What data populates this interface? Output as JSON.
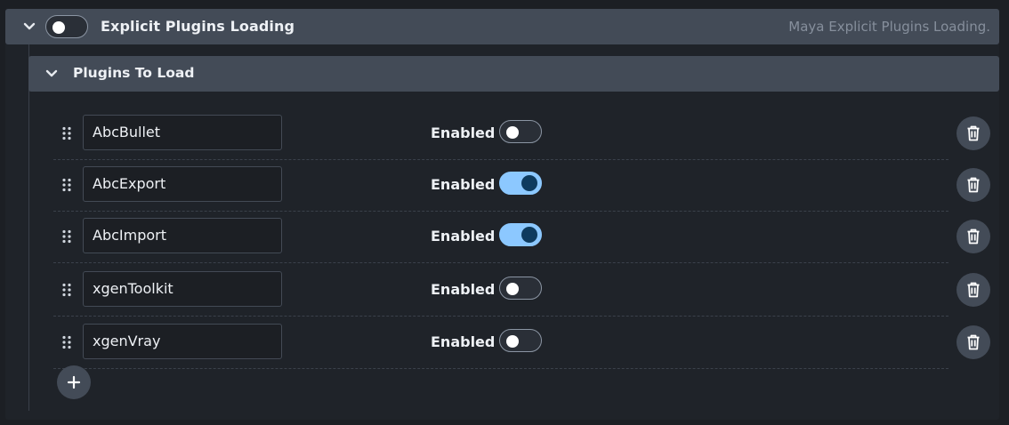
{
  "section": {
    "title": "Explicit Plugins Loading",
    "description": "Maya Explicit Plugins Loading.",
    "enabled": false,
    "expanded": true
  },
  "subsection": {
    "title": "Plugins To Load",
    "expanded": true
  },
  "plugins": [
    {
      "name": "AbcBullet",
      "enabled_label": "Enabled",
      "enabled": false
    },
    {
      "name": "AbcExport",
      "enabled_label": "Enabled",
      "enabled": true
    },
    {
      "name": "AbcImport",
      "enabled_label": "Enabled",
      "enabled": true
    },
    {
      "name": "xgenToolkit",
      "enabled_label": "Enabled",
      "enabled": false
    },
    {
      "name": "xgenVray",
      "enabled_label": "Enabled",
      "enabled": false
    }
  ],
  "icons": {
    "collapse": "chevron-down-icon",
    "drag": "drag-handle-icon",
    "delete": "trash-icon",
    "add": "plus-icon"
  },
  "colors": {
    "header_bg": "#434b57",
    "toggle_on": "#8cc8ff",
    "toggle_on_knob": "#0e3b5e"
  }
}
